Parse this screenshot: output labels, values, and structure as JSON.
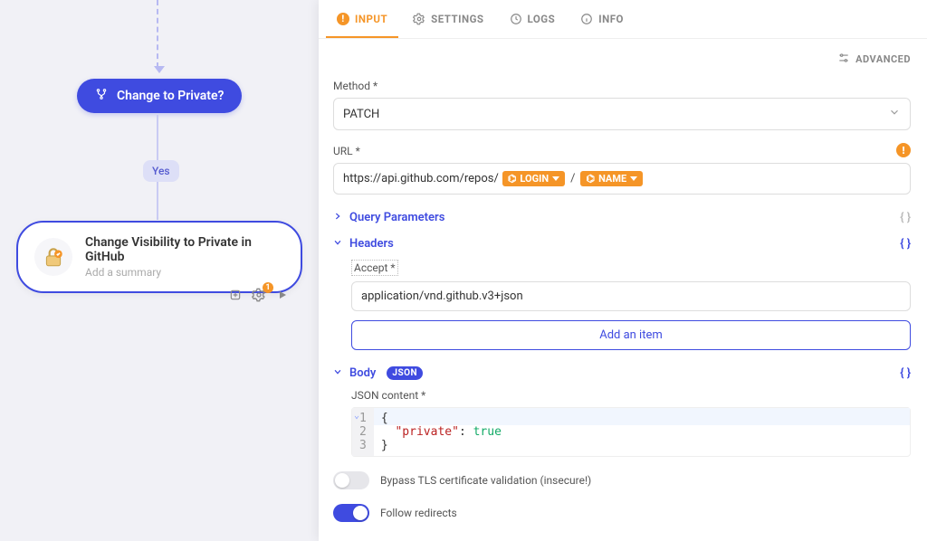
{
  "canvas": {
    "condition_label": "Change to Private?",
    "branch_label": "Yes",
    "step_title": "Change Visibility to Private in GitHub",
    "step_placeholder": "Add a summary",
    "badge_count": "1"
  },
  "panel": {
    "tabs": [
      {
        "key": "input",
        "label": "INPUT",
        "icon": "warning-circle-icon",
        "active": true
      },
      {
        "key": "settings",
        "label": "SETTINGS",
        "icon": "gear-icon",
        "active": false
      },
      {
        "key": "logs",
        "label": "LOGS",
        "icon": "clock-icon",
        "active": false
      },
      {
        "key": "info",
        "label": "INFO",
        "icon": "info-icon",
        "active": false
      }
    ],
    "advanced_label": "ADVANCED",
    "method": {
      "label": "Method",
      "value": "PATCH"
    },
    "url": {
      "label": "URL",
      "prefix": "https://api.github.com/repos/",
      "chip1_label": "LOGIN",
      "separator": "/",
      "chip2_label": "NAME"
    },
    "query_params_label": "Query Parameters",
    "headers": {
      "label": "Headers",
      "accept_label": "Accept",
      "accept_value": "application/vnd.github.v3+json",
      "add_button_label": "Add an item"
    },
    "body": {
      "label": "Body",
      "mode_badge": "JSON",
      "content_label": "JSON content",
      "lines": [
        "{",
        "  \"private\": true",
        "}"
      ]
    },
    "toggles": {
      "bypass_label": "Bypass TLS certificate validation (insecure!)",
      "bypass_on": false,
      "follow_label": "Follow redirects",
      "follow_on": true
    }
  }
}
